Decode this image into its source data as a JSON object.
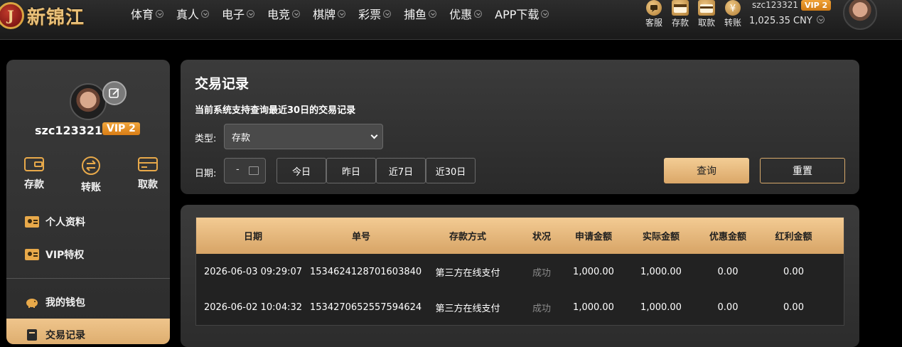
{
  "brand": {
    "logo_letter": "J",
    "name": "新锦江"
  },
  "nav": [
    "体育",
    "真人",
    "电子",
    "电竞",
    "棋牌",
    "彩票",
    "捕鱼",
    "优惠",
    "APP下载"
  ],
  "quick_actions": [
    "客服",
    "存款",
    "取款",
    "转账"
  ],
  "user": {
    "username": "szc123321",
    "vip_label": "VIP 2",
    "balance": "1,025.35 CNY"
  },
  "sidebar": {
    "username": "szc123321",
    "vip_label": "VIP 2",
    "actions": [
      "存款",
      "转账",
      "取款"
    ],
    "menu": [
      "个人资料",
      "VIP特权",
      "我的钱包",
      "交易记录"
    ]
  },
  "records": {
    "title": "交易记录",
    "subtitle": "当前系统支持查询最近30日的交易记录",
    "type_label": "类型:",
    "type_value": "存款",
    "date_label": "日期:",
    "date_value": "-",
    "ranges": [
      "今日",
      "昨日",
      "近7日",
      "近30日"
    ],
    "query_label": "查询",
    "reset_label": "重置"
  },
  "table": {
    "headers": [
      "日期",
      "单号",
      "存款方式",
      "状况",
      "申请金额",
      "实际金额",
      "优惠金额",
      "红利金额"
    ],
    "rows": [
      [
        "2026-06-03 09:29:07",
        "1534624128701603840",
        "第三方在线支付",
        "成功",
        "1,000.00",
        "1,000.00",
        "0.00",
        "0.00"
      ],
      [
        "2026-06-02 10:04:32",
        "1534270652557594624",
        "第三方在线支付",
        "成功",
        "1,000.00",
        "1,000.00",
        "0.00",
        "0.00"
      ]
    ]
  },
  "colors": {
    "accent_gold": "#d9a767",
    "vip_orange": "#e08a1c",
    "panel": "#333333"
  }
}
